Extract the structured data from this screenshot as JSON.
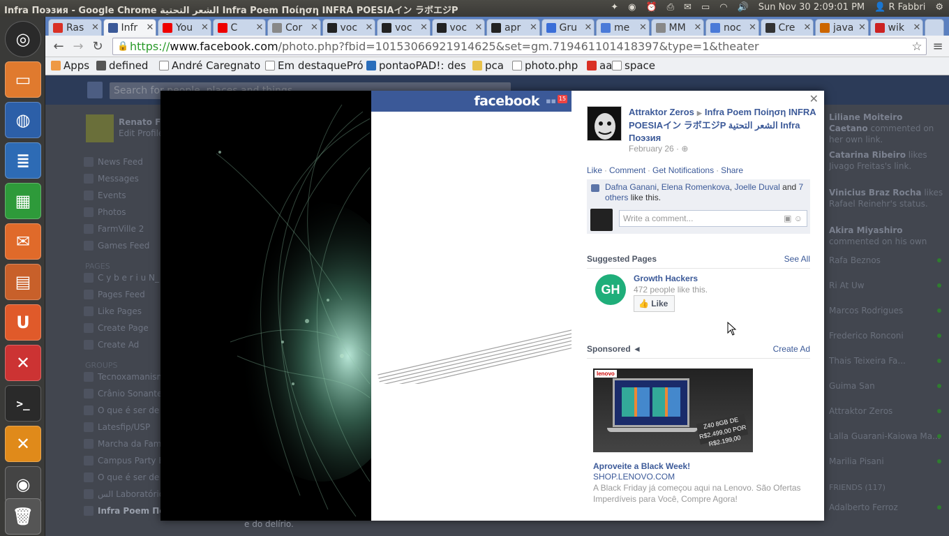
{
  "system": {
    "window_title": "Infra Поэзия - Google Chrome الشعر التحتية Infra Poem Ποίηση INFRA POESIAイン ラボエジP",
    "datetime": "Sun Nov 30  2:09:01 PM",
    "user": "R Fabbri"
  },
  "tabs": [
    {
      "label": "Ras",
      "icon": "gmail-icon",
      "color": "#d93025"
    },
    {
      "label": "Infr",
      "icon": "facebook-icon",
      "color": "#3b5998"
    },
    {
      "label": "You",
      "icon": "youtube-icon",
      "color": "#e00"
    },
    {
      "label": "C",
      "icon": "youtube-icon",
      "color": "#e00"
    },
    {
      "label": "Cor",
      "icon": "page-icon",
      "color": "#888"
    },
    {
      "label": "voc",
      "icon": "github-icon",
      "color": "#222"
    },
    {
      "label": "voc",
      "icon": "github-icon",
      "color": "#222"
    },
    {
      "label": "voc",
      "icon": "github-icon",
      "color": "#222"
    },
    {
      "label": "apr",
      "icon": "github-icon",
      "color": "#222"
    },
    {
      "label": "Gru",
      "icon": "groups-icon",
      "color": "#3a6ed8"
    },
    {
      "label": "me",
      "icon": "google-icon",
      "color": "#4a7ad8"
    },
    {
      "label": "MM",
      "icon": "page-icon",
      "color": "#888"
    },
    {
      "label": "noc",
      "icon": "google-icon",
      "color": "#4a7ad8"
    },
    {
      "label": "Cre",
      "icon": "image-icon",
      "color": "#333"
    },
    {
      "label": "java",
      "icon": "java-icon",
      "color": "#c60"
    },
    {
      "label": "wik",
      "icon": "wiki-icon",
      "color": "#c22"
    }
  ],
  "address": {
    "scheme": "https://",
    "host": "www.facebook.com",
    "path": "/photo.php?fbid=10153066921914625&set=gm.719461101418397&type=1&theater"
  },
  "bookmarks": [
    {
      "label": "Apps",
      "icon": "apps-grid-icon"
    },
    {
      "label": "defined",
      "icon": "w3-icon"
    },
    {
      "label": "André Caregnato",
      "icon": "page-icon"
    },
    {
      "label": "Em destaquePró",
      "icon": "page-icon"
    },
    {
      "label": "pontaoPAD!: des",
      "icon": "ep-icon"
    },
    {
      "label": "pca",
      "icon": "folder-icon"
    },
    {
      "label": "photo.php",
      "icon": "page-icon"
    },
    {
      "label": "aa",
      "icon": "gmail-icon"
    },
    {
      "label": "space",
      "icon": "page-icon"
    }
  ],
  "fb_background": {
    "search_placeholder": "Search for people, places and things",
    "profile_name": "Renato Fa",
    "edit_profile": "Edit Profile",
    "left_nav": [
      "News Feed",
      "Messages",
      "Events",
      "Photos",
      "FarmVille 2",
      "Games Feed"
    ],
    "pages_header": "PAGES",
    "pages": [
      "C y b e r i u N_",
      "Pages Feed",
      "Like Pages",
      "Create Page",
      "Create Ad"
    ],
    "groups_header": "GROUPS",
    "groups": [
      "Tecnoxamanism",
      "Crânio Sonante",
      "O que é ser de",
      "Latesfip/USP",
      "Marcha da Fam",
      "Campus Party B",
      "O que é ser de",
      "الس Laboratório M",
      "Infra Poem Ποίη..."
    ],
    "ticker": [
      {
        "name": "Liliane Moiteiro Caetano",
        "text": "commented on her own link."
      },
      {
        "name": "Catarina Ribeiro",
        "text": "likes Jivago Freitas's link."
      },
      {
        "name": "Vinicius Braz Rocha",
        "text": "likes Rafael Reinehr's status."
      },
      {
        "name": "Akira Miyashiro",
        "text": "commented on his own"
      }
    ],
    "chat": [
      "Rafa Beznos",
      "Ri At Uw",
      "Marcos Rodrigues",
      "Frederico Ronconi",
      "Thais Teixeira Fa...",
      "Guima San",
      "Attraktor Zeros",
      "Lalla Guarani-Kaiowa Ma...",
      "Marilia Pisani"
    ],
    "friends_header": "FRIENDS (117)",
    "chat_last": "Adalberto Ferroz",
    "post_fragment": "e do delírio."
  },
  "photo": {
    "fb_logo": "facebook",
    "notification_count": "15"
  },
  "post": {
    "author": "Attraktor Zeros",
    "group": "Infra Poem Ποίηση INFRA POESIAイン ラボエジP الشعر التحتية Infra Поэзия",
    "date": "February 26 · ",
    "actions": [
      "Like",
      "Comment",
      "Get Notifications",
      "Share"
    ],
    "likers": [
      "Dafna Ganani",
      "Elena Romenkova",
      "Joelle Duval"
    ],
    "likers_more": "7 others",
    "likers_suffix": "like this.",
    "comment_placeholder": "Write a comment..."
  },
  "suggested": {
    "header": "Suggested Pages",
    "see_all": "See All",
    "page_name": "Growth Hackers",
    "page_sub": "472 people like this.",
    "like_label": "Like",
    "logo_text": "GH"
  },
  "sponsored": {
    "header": "Sponsored",
    "create_ad": "Create Ad",
    "ad_brand": "lenovo",
    "ad_tag": "Z40 8GB DE R$2.499,00 POR R$2.199,00",
    "ad_title": "Aproveite a Black Week!",
    "ad_domain": "SHOP.LENOVO.COM",
    "ad_text": "A Black Friday já começou aqui na Lenovo. São Ofertas Imperdíveis para Você, Compre Agora!"
  }
}
